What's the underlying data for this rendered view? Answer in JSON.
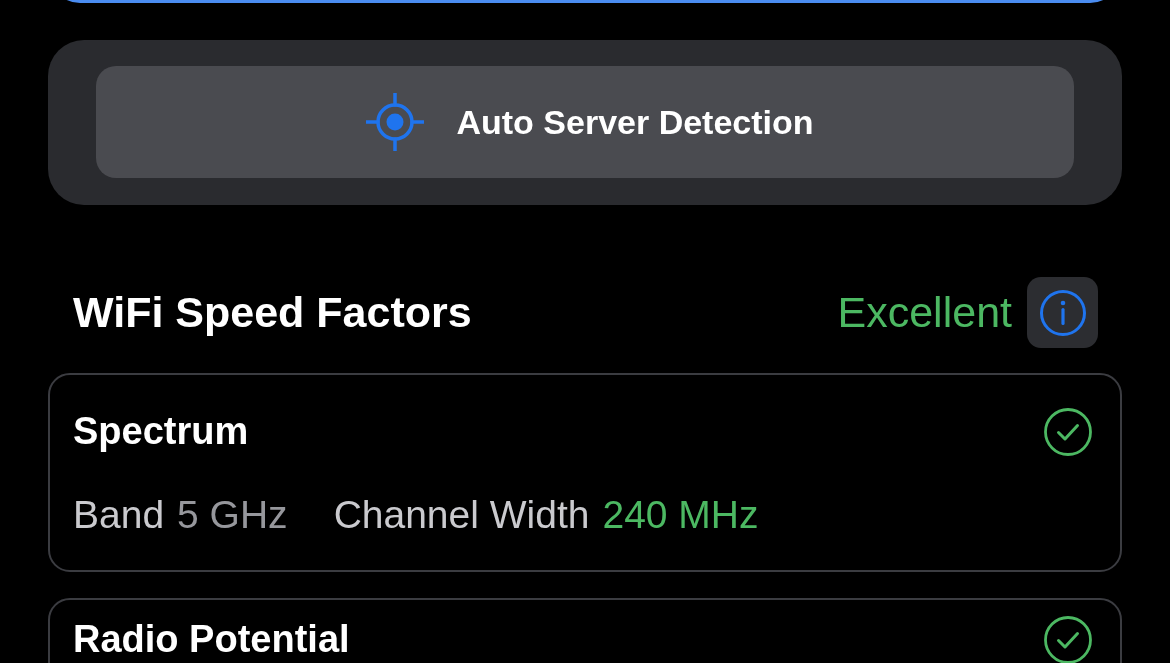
{
  "server_detection": {
    "label": "Auto Server Detection"
  },
  "speed_factors": {
    "title": "WiFi Speed Factors",
    "rating": "Excellent",
    "cards": [
      {
        "title": "Spectrum",
        "passed": true,
        "details": [
          {
            "label": "Band",
            "value": "5 GHz",
            "highlight": false
          },
          {
            "label": "Channel Width",
            "value": "240 MHz",
            "highlight": true
          }
        ]
      },
      {
        "title": "Radio Potential",
        "passed": true
      }
    ]
  }
}
